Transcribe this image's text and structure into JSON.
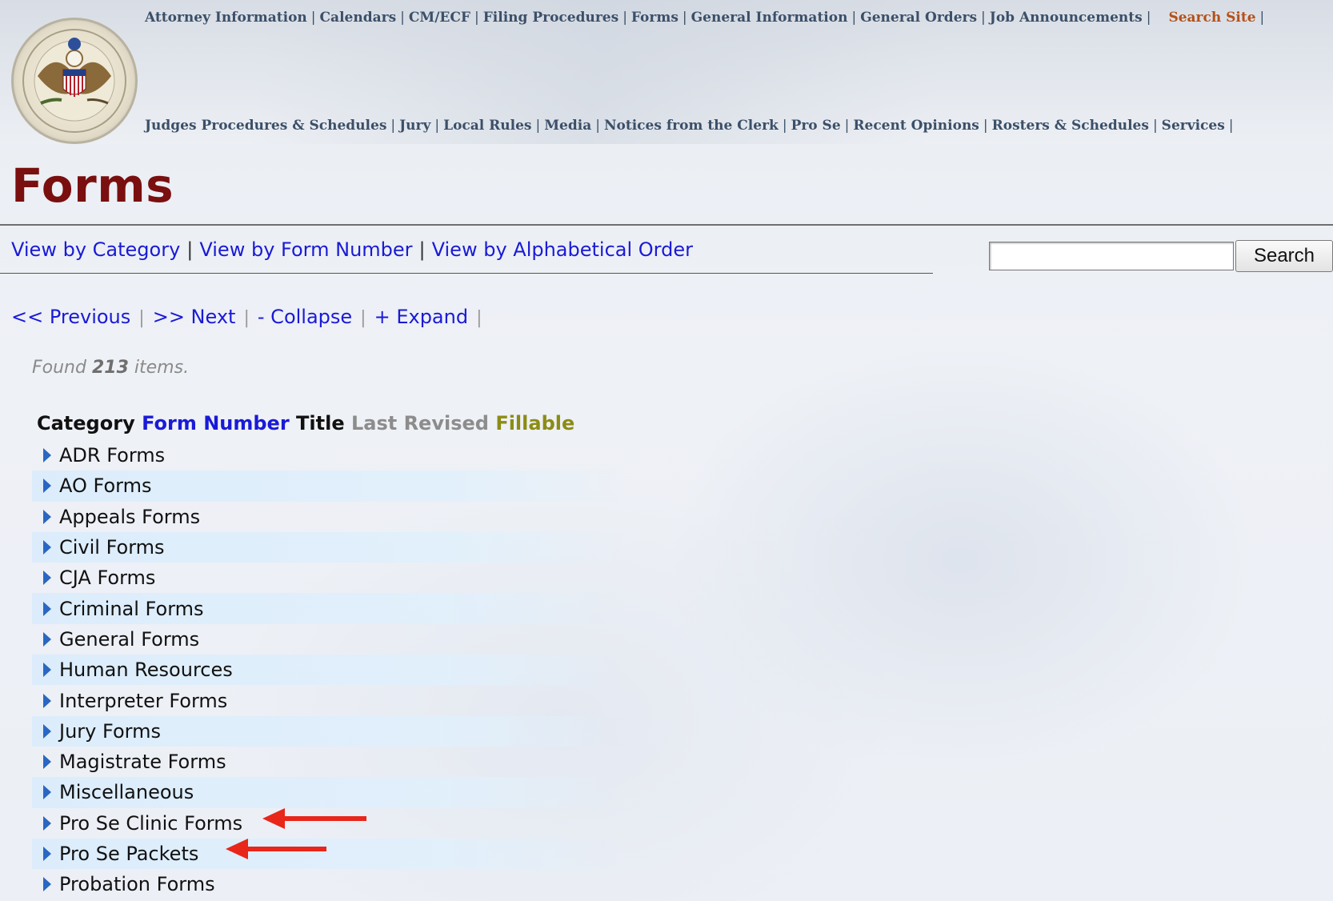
{
  "header": {
    "nav_row1": [
      "Attorney Information",
      "Calendars",
      "CM/ECF",
      "Filing Procedures",
      "Forms",
      "General Information",
      "General Orders",
      "Job Announcements"
    ],
    "search_site_label": "Search Site",
    "nav_row2": [
      "Judges Procedures & Schedules",
      "Jury",
      "Local Rules",
      "Media",
      "Notices from the Clerk",
      "Pro Se",
      "Recent Opinions",
      "Rosters & Schedules",
      "Services"
    ],
    "separator": "|"
  },
  "page": {
    "title": "Forms"
  },
  "view_links": {
    "by_category": "View by Category",
    "by_form_number": "View by Form Number",
    "by_alphabetical": "View by Alphabetical Order",
    "separator": "|"
  },
  "search": {
    "value": "",
    "button_label": "Search"
  },
  "pager": {
    "previous": "<< Previous",
    "next": ">> Next",
    "collapse": "- Collapse",
    "expand": "+ Expand",
    "separator": "|"
  },
  "results": {
    "found_prefix": "Found",
    "count": "213",
    "found_suffix": "items."
  },
  "sort_header": {
    "category": "Category",
    "form_number": "Form Number",
    "title": "Title",
    "last_revised": "Last Revised",
    "fillable": "Fillable"
  },
  "categories": [
    "ADR Forms",
    "AO Forms",
    "Appeals Forms",
    "Civil Forms",
    "CJA Forms",
    "Criminal Forms",
    "General Forms",
    "Human Resources",
    "Interpreter Forms",
    "Jury Forms",
    "Magistrate Forms",
    "Miscellaneous",
    "Pro Se Clinic Forms",
    "Pro Se Packets",
    "Probation Forms"
  ],
  "highlighted_items": [
    "Pro Se Clinic Forms",
    "Pro Se Packets"
  ],
  "colors": {
    "title": "#7a0f0f",
    "link": "#1a1ad6",
    "nav": "#3b4f68",
    "search_site": "#b5501a",
    "arrow": "#e8261a",
    "expand_triangle": "#2a67c2"
  },
  "icons": {
    "seal": "court-seal-icon",
    "expand": "triangle-right-icon",
    "annotation": "red-arrow-icon"
  }
}
